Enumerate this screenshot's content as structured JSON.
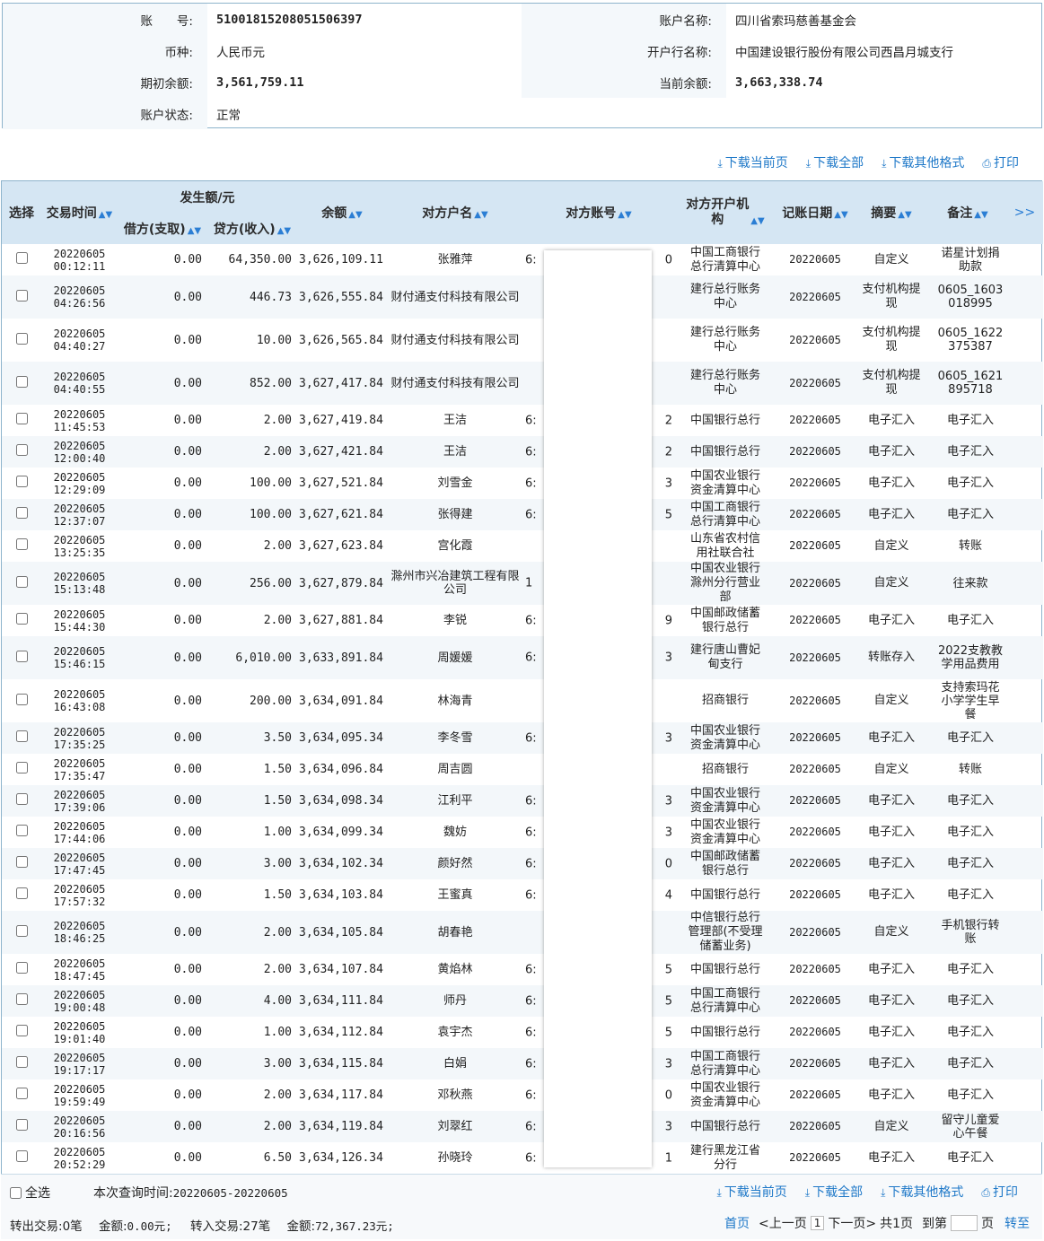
{
  "account": {
    "no_label": "账　　号:",
    "no_value": "51001815208051506397",
    "name_label": "账户名称:",
    "name_value": "四川省索玛慈善基金会",
    "currency_label": "币种:",
    "currency_value": "人民币元",
    "bank_label": "开户行名称:",
    "bank_value": "中国建设银行股份有限公司西昌月城支行",
    "opening_label": "期初余额:",
    "opening_value": "3,561,759.11",
    "current_label": "当前余额:",
    "current_value": "3,663,338.74",
    "status_label": "账户状态:",
    "status_value": "正常"
  },
  "toolbar": {
    "download_page": "下载当前页",
    "download_all": "下载全部",
    "download_other": "下载其他格式",
    "print": "打印"
  },
  "columns": {
    "select": "选择",
    "time": "交易时间",
    "amount_group": "发生额/元",
    "debit": "借方(支取)",
    "credit": "贷方(收入)",
    "balance": "余额",
    "cp_name": "对方户名",
    "cp_account": "对方账号",
    "cp_bank": "对方开户机构",
    "post_date": "记账日期",
    "summary": "摘要",
    "remark": "备注",
    "more": ">>"
  },
  "rows": [
    {
      "date": "20220605",
      "time": "00:12:11",
      "debit": "0.00",
      "credit": "64,350.00",
      "balance": "3,626,109.11",
      "name": "张雅萍",
      "acct_start": "6:",
      "acct_end": "0",
      "bank": "中国工商银行总行清算中心",
      "post": "20220605",
      "summary": "自定义",
      "remark": "诺星计划捐助款"
    },
    {
      "date": "20220605",
      "time": "04:26:56",
      "debit": "0.00",
      "credit": "446.73",
      "balance": "3,626,555.84",
      "name": "财付通支付科技有限公司",
      "acct_start": "",
      "acct_end": "",
      "bank": "建行总行账务中心",
      "post": "20220605",
      "summary": "支付机构提现",
      "remark": "0605_1603018995"
    },
    {
      "date": "20220605",
      "time": "04:40:27",
      "debit": "0.00",
      "credit": "10.00",
      "balance": "3,626,565.84",
      "name": "财付通支付科技有限公司",
      "acct_start": "",
      "acct_end": "",
      "bank": "建行总行账务中心",
      "post": "20220605",
      "summary": "支付机构提现",
      "remark": "0605_1622375387"
    },
    {
      "date": "20220605",
      "time": "04:40:55",
      "debit": "0.00",
      "credit": "852.00",
      "balance": "3,627,417.84",
      "name": "财付通支付科技有限公司",
      "acct_start": "",
      "acct_end": "",
      "bank": "建行总行账务中心",
      "post": "20220605",
      "summary": "支付机构提现",
      "remark": "0605_1621895718"
    },
    {
      "date": "20220605",
      "time": "11:45:53",
      "debit": "0.00",
      "credit": "2.00",
      "balance": "3,627,419.84",
      "name": "王洁",
      "acct_start": "6:",
      "acct_end": "2",
      "bank": "中国银行总行",
      "post": "20220605",
      "summary": "电子汇入",
      "remark": "电子汇入"
    },
    {
      "date": "20220605",
      "time": "12:00:40",
      "debit": "0.00",
      "credit": "2.00",
      "balance": "3,627,421.84",
      "name": "王洁",
      "acct_start": "6:",
      "acct_end": "2",
      "bank": "中国银行总行",
      "post": "20220605",
      "summary": "电子汇入",
      "remark": "电子汇入"
    },
    {
      "date": "20220605",
      "time": "12:29:09",
      "debit": "0.00",
      "credit": "100.00",
      "balance": "3,627,521.84",
      "name": "刘雪金",
      "acct_start": "6:",
      "acct_end": "3",
      "bank": "中国农业银行资金清算中心",
      "post": "20220605",
      "summary": "电子汇入",
      "remark": "电子汇入"
    },
    {
      "date": "20220605",
      "time": "12:37:07",
      "debit": "0.00",
      "credit": "100.00",
      "balance": "3,627,621.84",
      "name": "张得建",
      "acct_start": "6:",
      "acct_end": "5",
      "bank": "中国工商银行总行清算中心",
      "post": "20220605",
      "summary": "电子汇入",
      "remark": "电子汇入"
    },
    {
      "date": "20220605",
      "time": "13:25:35",
      "debit": "0.00",
      "credit": "2.00",
      "balance": "3,627,623.84",
      "name": "宫化霞",
      "acct_start": "",
      "acct_end": "",
      "bank": "山东省农村信用社联合社",
      "post": "20220605",
      "summary": "自定义",
      "remark": "转账"
    },
    {
      "date": "20220605",
      "time": "15:13:48",
      "debit": "0.00",
      "credit": "256.00",
      "balance": "3,627,879.84",
      "name": "滁州市兴冶建筑工程有限公司",
      "acct_start": "1",
      "acct_end": "",
      "bank": "中国农业银行滁州分行营业部",
      "post": "20220605",
      "summary": "自定义",
      "remark": "往来款"
    },
    {
      "date": "20220605",
      "time": "15:44:30",
      "debit": "0.00",
      "credit": "2.00",
      "balance": "3,627,881.84",
      "name": "李锐",
      "acct_start": "6:",
      "acct_end": "9",
      "bank": "中国邮政储蓄银行总行",
      "post": "20220605",
      "summary": "电子汇入",
      "remark": "电子汇入"
    },
    {
      "date": "20220605",
      "time": "15:46:15",
      "debit": "0.00",
      "credit": "6,010.00",
      "balance": "3,633,891.84",
      "name": "周媛媛",
      "acct_start": "6:",
      "acct_end": "3",
      "bank": "建行唐山曹妃甸支行",
      "post": "20220605",
      "summary": "转账存入",
      "remark": "2022支教教学用品费用"
    },
    {
      "date": "20220605",
      "time": "16:43:08",
      "debit": "0.00",
      "credit": "200.00",
      "balance": "3,634,091.84",
      "name": "林海青",
      "acct_start": "",
      "acct_end": "",
      "bank": "招商银行",
      "post": "20220605",
      "summary": "自定义",
      "remark": "支持索玛花小学学生早餐"
    },
    {
      "date": "20220605",
      "time": "17:35:25",
      "debit": "0.00",
      "credit": "3.50",
      "balance": "3,634,095.34",
      "name": "李冬雪",
      "acct_start": "6:",
      "acct_end": "3",
      "bank": "中国农业银行资金清算中心",
      "post": "20220605",
      "summary": "电子汇入",
      "remark": "电子汇入"
    },
    {
      "date": "20220605",
      "time": "17:35:47",
      "debit": "0.00",
      "credit": "1.50",
      "balance": "3,634,096.84",
      "name": "周吉圆",
      "acct_start": "",
      "acct_end": "",
      "bank": "招商银行",
      "post": "20220605",
      "summary": "自定义",
      "remark": "转账"
    },
    {
      "date": "20220605",
      "time": "17:39:06",
      "debit": "0.00",
      "credit": "1.50",
      "balance": "3,634,098.34",
      "name": "江利平",
      "acct_start": "6:",
      "acct_end": "3",
      "bank": "中国农业银行资金清算中心",
      "post": "20220605",
      "summary": "电子汇入",
      "remark": "电子汇入"
    },
    {
      "date": "20220605",
      "time": "17:44:06",
      "debit": "0.00",
      "credit": "1.00",
      "balance": "3,634,099.34",
      "name": "魏妨",
      "acct_start": "6:",
      "acct_end": "3",
      "bank": "中国农业银行资金清算中心",
      "post": "20220605",
      "summary": "电子汇入",
      "remark": "电子汇入"
    },
    {
      "date": "20220605",
      "time": "17:47:45",
      "debit": "0.00",
      "credit": "3.00",
      "balance": "3,634,102.34",
      "name": "颜好然",
      "acct_start": "6:",
      "acct_end": "0",
      "bank": "中国邮政储蓄银行总行",
      "post": "20220605",
      "summary": "电子汇入",
      "remark": "电子汇入"
    },
    {
      "date": "20220605",
      "time": "17:57:32",
      "debit": "0.00",
      "credit": "1.50",
      "balance": "3,634,103.84",
      "name": "王蜜真",
      "acct_start": "6:",
      "acct_end": "4",
      "bank": "中国银行总行",
      "post": "20220605",
      "summary": "电子汇入",
      "remark": "电子汇入"
    },
    {
      "date": "20220605",
      "time": "18:46:25",
      "debit": "0.00",
      "credit": "2.00",
      "balance": "3,634,105.84",
      "name": "胡春艳",
      "acct_start": "",
      "acct_end": "",
      "bank": "中信银行总行管理部(不受理储蓄业务)",
      "post": "20220605",
      "summary": "自定义",
      "remark": "手机银行转账"
    },
    {
      "date": "20220605",
      "time": "18:47:45",
      "debit": "0.00",
      "credit": "2.00",
      "balance": "3,634,107.84",
      "name": "黄焰林",
      "acct_start": "6:",
      "acct_end": "5",
      "bank": "中国银行总行",
      "post": "20220605",
      "summary": "电子汇入",
      "remark": "电子汇入"
    },
    {
      "date": "20220605",
      "time": "19:00:48",
      "debit": "0.00",
      "credit": "4.00",
      "balance": "3,634,111.84",
      "name": "师丹",
      "acct_start": "6:",
      "acct_end": "5",
      "bank": "中国工商银行总行清算中心",
      "post": "20220605",
      "summary": "电子汇入",
      "remark": "电子汇入"
    },
    {
      "date": "20220605",
      "time": "19:01:40",
      "debit": "0.00",
      "credit": "1.00",
      "balance": "3,634,112.84",
      "name": "袁宇杰",
      "acct_start": "6:",
      "acct_end": "5",
      "bank": "中国银行总行",
      "post": "20220605",
      "summary": "电子汇入",
      "remark": "电子汇入"
    },
    {
      "date": "20220605",
      "time": "19:17:17",
      "debit": "0.00",
      "credit": "3.00",
      "balance": "3,634,115.84",
      "name": "白娟",
      "acct_start": "6:",
      "acct_end": "3",
      "bank": "中国工商银行总行清算中心",
      "post": "20220605",
      "summary": "电子汇入",
      "remark": "电子汇入"
    },
    {
      "date": "20220605",
      "time": "19:59:49",
      "debit": "0.00",
      "credit": "2.00",
      "balance": "3,634,117.84",
      "name": "邓秋燕",
      "acct_start": "6:",
      "acct_end": "0",
      "bank": "中国农业银行资金清算中心",
      "post": "20220605",
      "summary": "电子汇入",
      "remark": "电子汇入"
    },
    {
      "date": "20220605",
      "time": "20:16:56",
      "debit": "0.00",
      "credit": "2.00",
      "balance": "3,634,119.84",
      "name": "刘翠红",
      "acct_start": "6:",
      "acct_end": "3",
      "bank": "中国银行总行",
      "post": "20220605",
      "summary": "自定义",
      "remark": "留守儿童爱心午餐"
    },
    {
      "date": "20220605",
      "time": "20:52:29",
      "debit": "0.00",
      "credit": "6.50",
      "balance": "3,634,126.34",
      "name": "孙晓玲",
      "acct_start": "6:",
      "acct_end": "1",
      "bank": "建行黑龙江省分行",
      "post": "20220605",
      "summary": "电子汇入",
      "remark": "电子汇入"
    }
  ],
  "footer": {
    "select_all": "全选",
    "query_time_label": "本次查询时间:",
    "query_time_value": "20220605-20220605",
    "out_label": "转出交易:",
    "out_count": "0笔",
    "out_amount_label": "金额:",
    "out_amount": "0.00元;",
    "in_label": "转入交易:",
    "in_count": "27笔",
    "in_amount_label": "金额:",
    "in_amount": "72,367.23元;"
  },
  "pager": {
    "first": "首页",
    "prev": "<上一页",
    "current": "1",
    "next": "下一页>",
    "total": "共1页",
    "goto_prefix": "到第",
    "goto_suffix": "页",
    "go": "转至"
  },
  "colors": {
    "accent": "#1e78c8",
    "header_bg": "#d5e6f3",
    "border": "#8eb4cc",
    "sort_icon": "#2b7ed4"
  }
}
